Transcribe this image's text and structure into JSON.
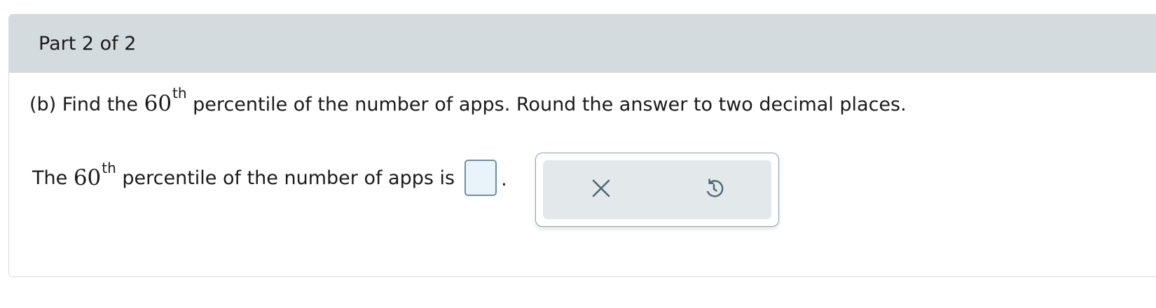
{
  "header": {
    "part_label": "Part 2 of 2"
  },
  "question": {
    "prefix": "(b) Find the ",
    "ordinal_number": "60",
    "ordinal_suffix": "th",
    "suffix": " percentile of the number of apps. Round the answer to two decimal places."
  },
  "answer": {
    "prefix": "The ",
    "ordinal_number": "60",
    "ordinal_suffix": "th",
    "suffix": " percentile of the number of apps is",
    "input_value": "",
    "period": "."
  },
  "tools": {
    "clear_icon": "x-icon",
    "undo_icon": "undo-icon"
  },
  "colors": {
    "header_bg": "#d4dbdf",
    "input_bg": "#e8f3fa",
    "input_border": "#6d8fa6",
    "tool_icon": "#4d6878"
  }
}
